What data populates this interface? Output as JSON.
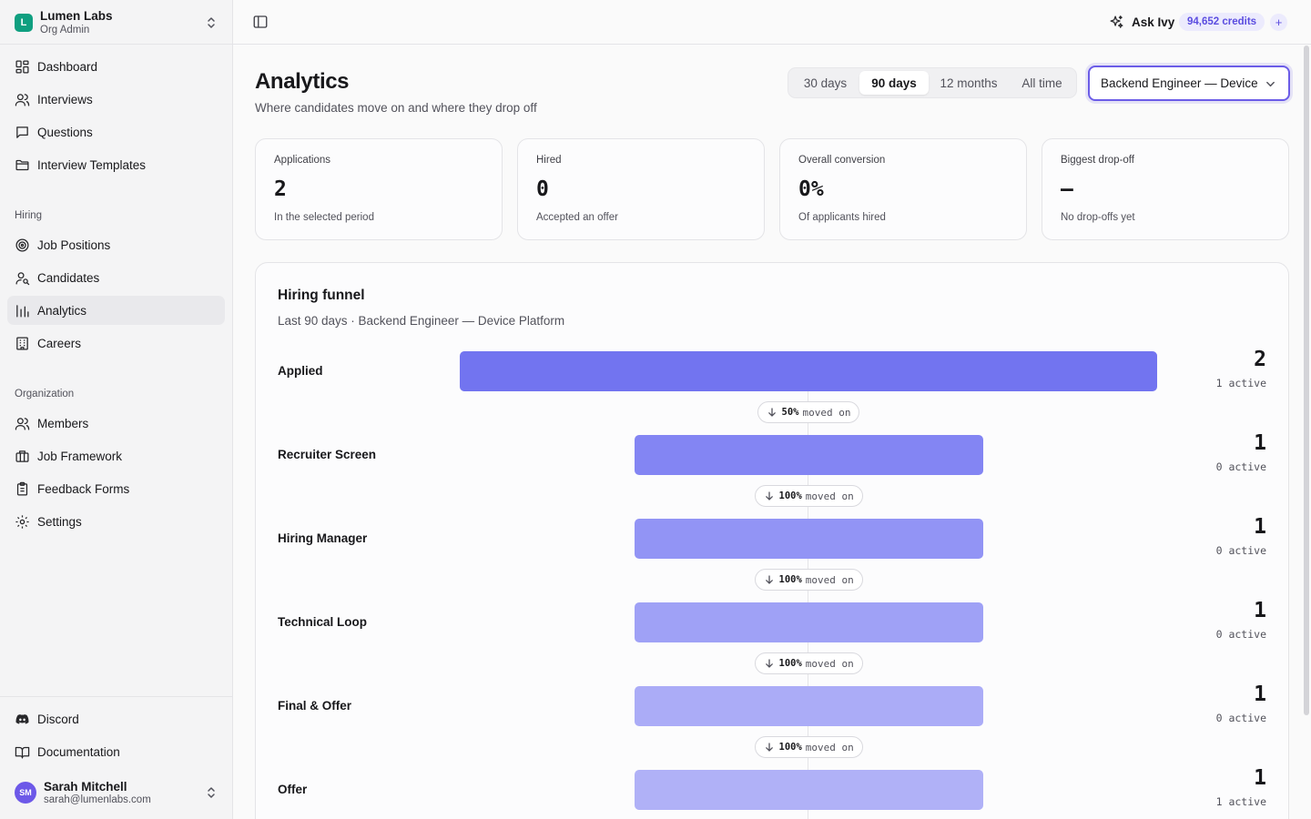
{
  "org": {
    "logo": "L",
    "name": "Lumen Labs",
    "role": "Org Admin"
  },
  "nav": {
    "main": [
      {
        "label": "Dashboard",
        "icon": "dashboard-icon"
      },
      {
        "label": "Interviews",
        "icon": "users-icon"
      },
      {
        "label": "Questions",
        "icon": "message-icon"
      },
      {
        "label": "Interview Templates",
        "icon": "folder-icon"
      }
    ],
    "hiring_label": "Hiring",
    "hiring": [
      {
        "label": "Job Positions",
        "icon": "target-icon"
      },
      {
        "label": "Candidates",
        "icon": "user-search-icon"
      },
      {
        "label": "Analytics",
        "icon": "bar-chart-icon",
        "active": true
      },
      {
        "label": "Careers",
        "icon": "building-icon"
      }
    ],
    "organization_label": "Organization",
    "organization": [
      {
        "label": "Members",
        "icon": "users-icon"
      },
      {
        "label": "Job Framework",
        "icon": "briefcase-icon"
      },
      {
        "label": "Feedback Forms",
        "icon": "clipboard-icon"
      },
      {
        "label": "Settings",
        "icon": "gear-icon"
      }
    ],
    "footer": [
      {
        "label": "Discord",
        "icon": "discord-icon"
      },
      {
        "label": "Documentation",
        "icon": "book-icon"
      }
    ]
  },
  "user": {
    "initials": "SM",
    "name": "Sarah Mitchell",
    "email": "sarah@lumenlabs.com"
  },
  "topbar": {
    "ask_label": "Ask Ivy",
    "credits": "94,652 credits",
    "plus": "+"
  },
  "page": {
    "title": "Analytics",
    "subtitle": "Where candidates move on and where they drop off"
  },
  "range": {
    "options": [
      "30 days",
      "90 days",
      "12 months",
      "All time"
    ],
    "selected": "90 days"
  },
  "position_select": {
    "value": "Backend Engineer — Device Platform"
  },
  "stats": [
    {
      "label": "Applications",
      "value": "2",
      "sub": "In the selected period"
    },
    {
      "label": "Hired",
      "value": "0",
      "sub": "Accepted an offer"
    },
    {
      "label": "Overall conversion",
      "value": "0%",
      "sub": "Of applicants hired"
    },
    {
      "label": "Biggest drop-off",
      "value": "—",
      "sub": "No drop-offs yet"
    }
  ],
  "funnel": {
    "title": "Hiring funnel",
    "subtitle": "Last 90 days · Backend Engineer — Device Platform",
    "moved_on_suffix": "moved on",
    "colors": [
      "#7274f0",
      "#8385f3",
      "#9294f5",
      "#9fa1f6",
      "#abacf7",
      "#b0b1f7"
    ]
  },
  "chart_data": {
    "type": "bar",
    "title": "Hiring funnel",
    "categories": [
      "Applied",
      "Recruiter Screen",
      "Hiring Manager",
      "Technical Loop",
      "Final & Offer",
      "Offer"
    ],
    "values": [
      2,
      1,
      1,
      1,
      1,
      1
    ],
    "active_labels": [
      "1 active",
      "0 active",
      "0 active",
      "0 active",
      "0 active",
      "1 active"
    ],
    "conversion": [
      "50%",
      "100%",
      "100%",
      "100%",
      "100%"
    ]
  }
}
